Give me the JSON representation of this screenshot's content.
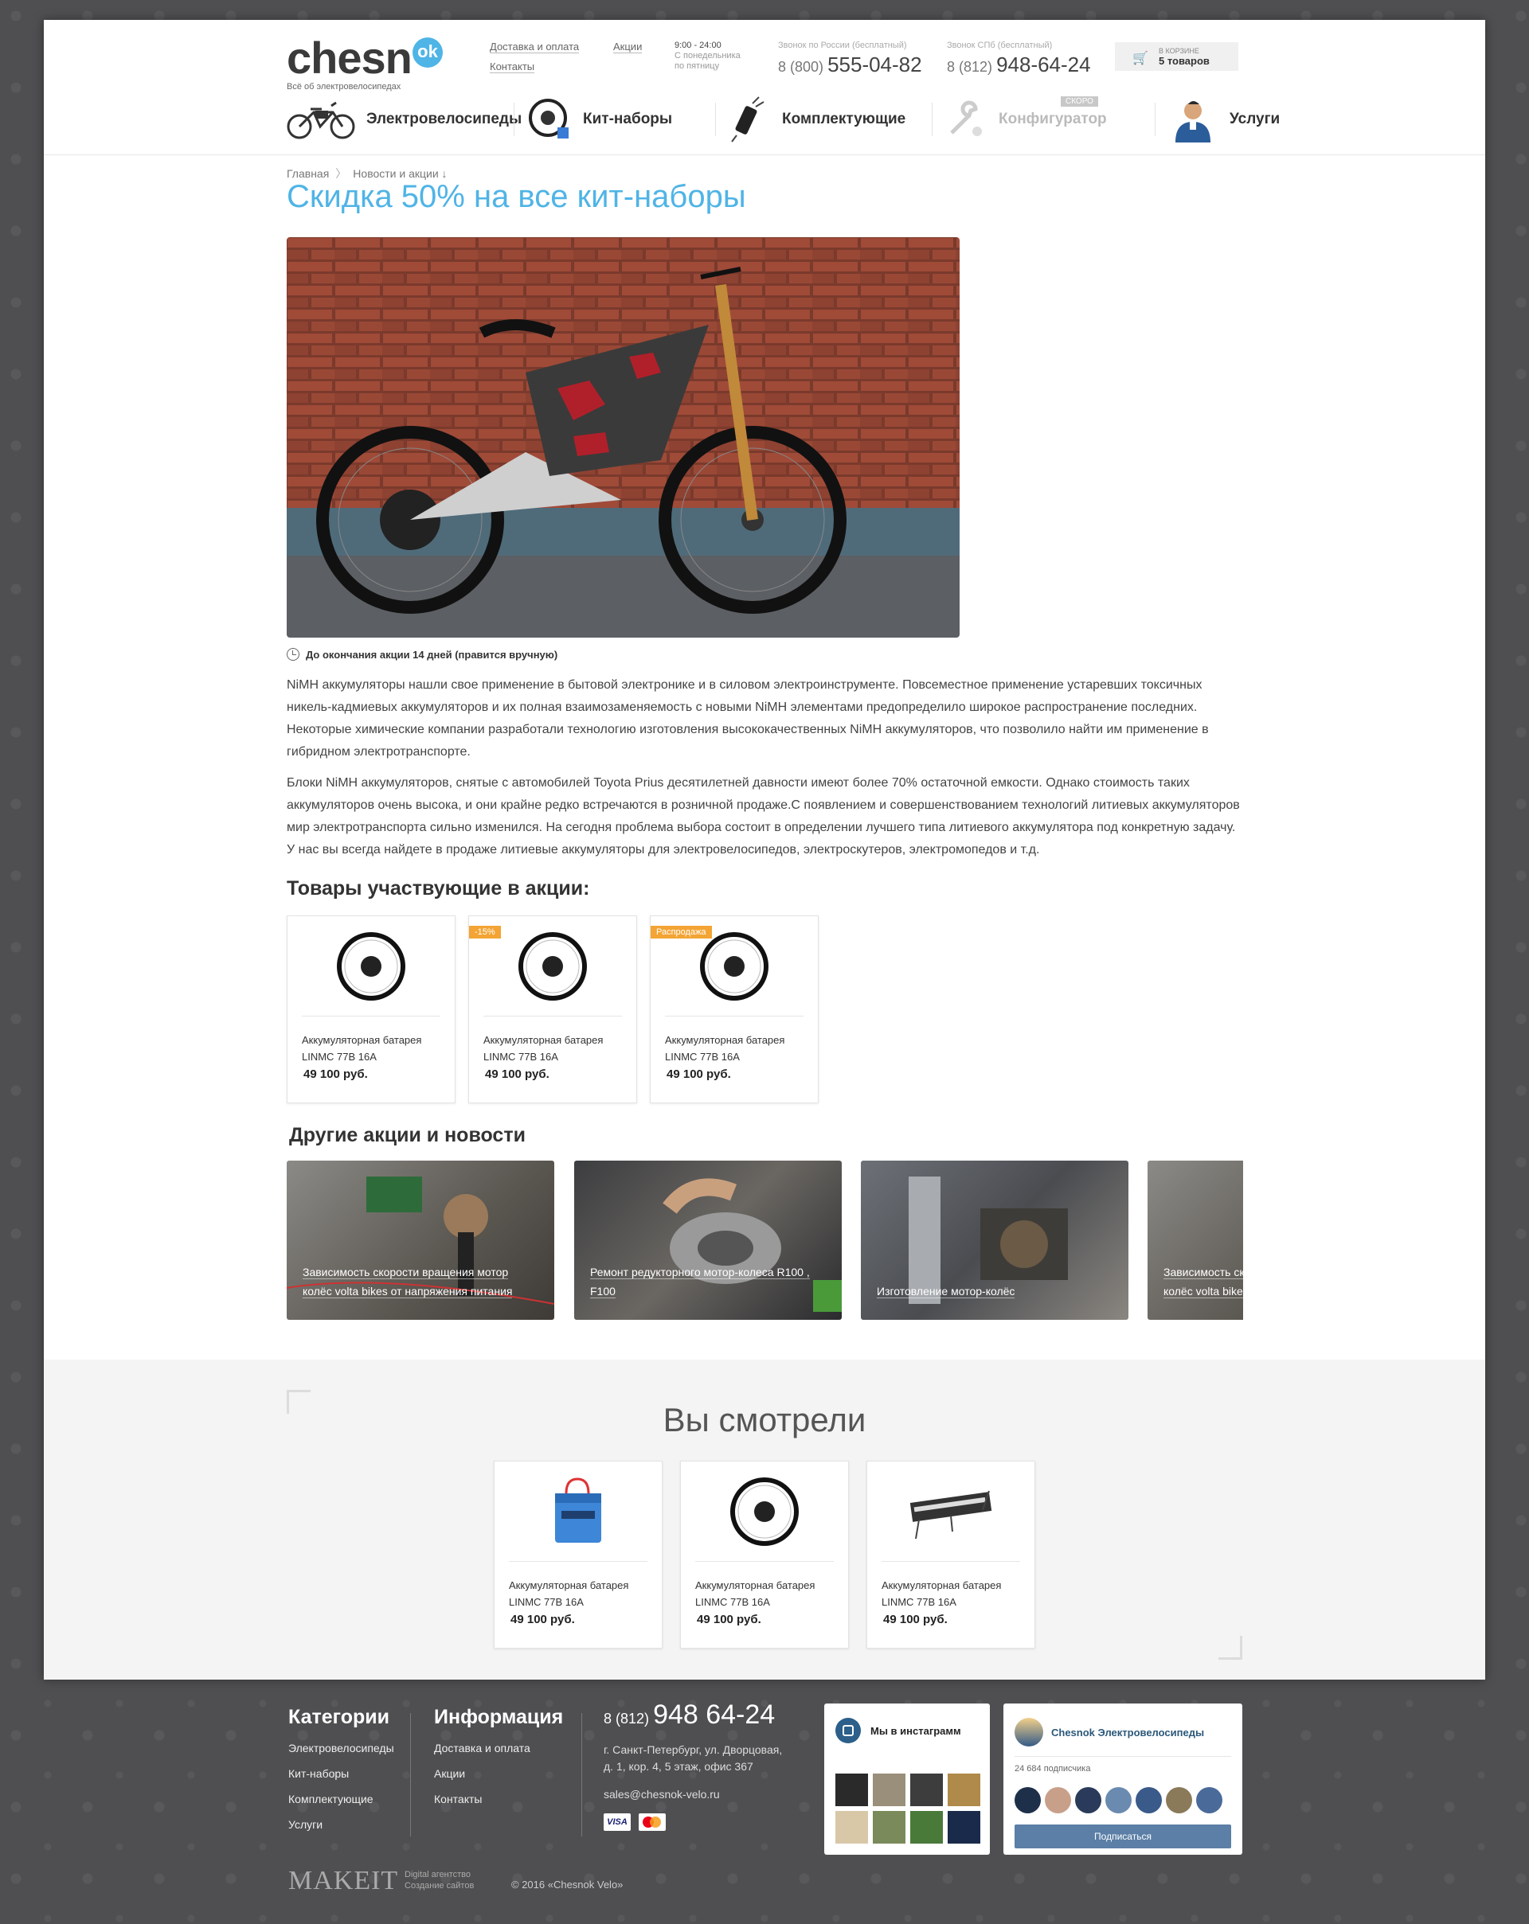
{
  "header": {
    "logo_text": "chesn",
    "logo_badge": "ok",
    "logo_tagline": "Всё об электровелосипедах",
    "links": [
      "Доставка и оплата",
      "Акции",
      "Контакты"
    ],
    "hours_time": "9:00 - 24:00",
    "hours_days": "С понедельника",
    "hours_days2": "по пятницу",
    "phone1_caption": "Звонок по России (бесплатный)",
    "phone1_prefix": "8 (800)",
    "phone1_number": "555-04-82",
    "phone2_caption": "Звонок СПб (бесплатный)",
    "phone2_prefix": "8 (812)",
    "phone2_number": "948-64-24",
    "cart_caption": "в корзине",
    "cart_count": "5 товаров"
  },
  "nav": {
    "items": [
      {
        "label": "Электровелосипеды",
        "icon": "ebike-icon"
      },
      {
        "label": "Кит-наборы",
        "icon": "motor-wheel-icon"
      },
      {
        "label": "Комплектующие",
        "icon": "controller-icon"
      },
      {
        "label": "Конфигуратор",
        "icon": "wrench-icon",
        "badge": "скоро"
      },
      {
        "label": "Услуги",
        "icon": "mechanic-icon"
      }
    ]
  },
  "breadcrumb": [
    "Главная",
    "Новости и акции ↓"
  ],
  "page": {
    "title": "Скидка 50% на все кит-наборы",
    "timer": "До окончания акции 14 дней (правится вручную)",
    "paragraph1": "NiMH аккумуляторы нашли свое применение в бытовой электронике и в силовом электроинструменте. Повсеместное применение устаревших токсичных никель-кадмиевых аккумуляторов и их полная взаимозаменяемость с новыми NiMH элементами предопределило широкое распространение последних. Некоторые химические компании разработали технологию изготовления высококачественных NiMH аккумуляторов, что позволило найти им применение в гибридном электротранспорте.",
    "paragraph2": "Блоки NiMH аккумуляторов, снятые с автомобилей Toyota Prius десятилетней давности имеют более 70% остаточной емкости. Однако стоимость таких аккумуляторов очень высока, и они крайне редко встречаются в розничной продаже.С появлением и совершенствованием технологий литиевых аккумуляторов мир электротранспорта сильно изменился. На сегодня проблема выбора состоит в определении лучшего типа литиевого аккумулятора под конкретную задачу. У нас вы всегда найдете в продаже литиевые аккумуляторы для электровелосипедов, электроскутеров, электромопедов и т.д.",
    "products_heading": "Товары участвующие в акции:",
    "news_heading": "Другие акции и новости"
  },
  "products": [
    {
      "name": "Аккумуляторная батарея LINMC 77В 16А",
      "price": "49 100 руб.",
      "badge": ""
    },
    {
      "name": "Аккумуляторная батарея LINMC 77В 16А",
      "price": "49 100 руб.",
      "badge": "-15%"
    },
    {
      "name": "Аккумуляторная батарея LINMC 77В 16А",
      "price": "49 100 руб.",
      "badge": "Распродажа"
    }
  ],
  "news": [
    {
      "caption": "Зависимость скорости вращения мотор колёс volta bikes от напряжения питания"
    },
    {
      "caption": "Ремонт редукторного мотор-колеса R100 , F100"
    },
    {
      "caption": "Изготовление мотор-колёс"
    },
    {
      "caption": "Зависимость скорости вращения мотор колёс volta bikes от напряжения питания"
    }
  ],
  "viewed": {
    "title": "Вы смотрели",
    "items": [
      {
        "name": "Аккумуляторная батарея LINMC 77В 16А",
        "price": "49 100 руб.",
        "icon": "battery-icon"
      },
      {
        "name": "Аккумуляторная батарея LINMC 77В 16А",
        "price": "49 100 руб.",
        "icon": "motor-wheel-icon"
      },
      {
        "name": "Аккумуляторная батарея LINMC 77В 16А",
        "price": "49 100 руб.",
        "icon": "controller-icon"
      }
    ]
  },
  "footer": {
    "categories_title": "Категории",
    "categories": [
      "Электровелосипеды",
      "Кит-наборы",
      "Комплектующие",
      "Услуги"
    ],
    "info_title": "Информация",
    "info": [
      "Доставка и оплата",
      "Акции",
      "Контакты"
    ],
    "phone_prefix": "8 (812)",
    "phone_number": "948 64-24",
    "address_line1": "г. Санкт-Петербург, ул. Дворцовая,",
    "address_line2": "д. 1, кор. 4, 5 этаж, офис 367",
    "email": "sales@chesnok-velo.ru",
    "visa": "VISA",
    "instagram_title": "Мы в инстаграмм",
    "vk_title": "Chesnok Электровелосипеды",
    "vk_subscribers": "24 684 подписчика",
    "vk_button": "Подписаться",
    "makeit": "MAKEIT",
    "makeit_sub1": "Digital агентство",
    "makeit_sub2": "Создание сайтов",
    "copyright": "© 2016 «Chesnok Velo»"
  },
  "colors": {
    "accent": "#4fb4e6",
    "badge_orange": "#f3a434",
    "vk_button": "#5b7fa6",
    "page_bg": "#4f4f51"
  }
}
